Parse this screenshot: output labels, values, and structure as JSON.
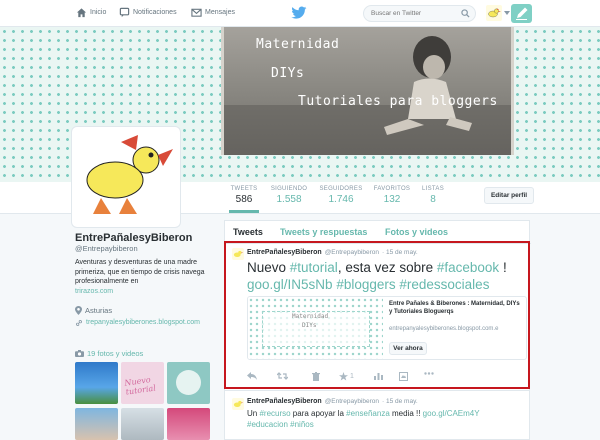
{
  "nav": {
    "home": "Inicio",
    "notifications": "Notificaciones",
    "messages": "Mensajes",
    "search_placeholder": "Buscar en Twitter"
  },
  "banner": {
    "line1": "Maternidad",
    "line2": "DIYs",
    "line3": "Tutoriales para bloggers"
  },
  "stats": [
    {
      "label": "TWEETS",
      "value": "586"
    },
    {
      "label": "SIGUIENDO",
      "value": "1.558"
    },
    {
      "label": "SEGUIDORES",
      "value": "1.746"
    },
    {
      "label": "FAVORITOS",
      "value": "132"
    },
    {
      "label": "LISTAS",
      "value": "8"
    }
  ],
  "edit_profile": "Editar perfil",
  "profile": {
    "name": "EntrePañalesyBiberon",
    "handle": "@Entrepaybiberon",
    "bio": "Aventuras y desventuras de una madre primeriza, que en tiempo de crisis navega profesionalmente en",
    "bio_link": "trirazos.com",
    "location": "Asturias",
    "website": "trepanyalesybiberones.blogspot.com",
    "media_label": "19 fotos y videos",
    "thumb_label": "Nuevo tutorial"
  },
  "tabs": {
    "tweets": "Tweets",
    "replies": "Tweets y respuestas",
    "media": "Fotos y videos"
  },
  "tweet1": {
    "name": "EntrePañalesyBiberon",
    "handle": "@Entrepaybiberon",
    "date": "· 15 de may.",
    "text_a": "Nuevo ",
    "tag_a": "#tutorial",
    "text_b": ", esta vez sobre ",
    "tag_b": "#facebook",
    "text_c": " !",
    "link": "goo.gl/IN5sNb",
    "tag_c": "#bloggers",
    "tag_d": "#redessociales",
    "card_title": "Entre Pañales & Biberones : Maternidad, DIYs y Tutoriales Bloguerqs",
    "card_url": "entrepanyalesybiberones.blogspot.com.e",
    "card_button": "Ver ahora",
    "card_img_line1": "Maternidad",
    "card_img_line2": "DIYs"
  },
  "tweet2": {
    "name": "EntrePañalesyBiberon",
    "handle": "@Entrepaybiberon",
    "date": "· 15 de may.",
    "text_a": "Un ",
    "tag_a": "#recurso",
    "text_b": " para apoyar la ",
    "tag_b": "#enseñanza",
    "text_c": " media !! ",
    "link": "goo.gl/CAEm4Y",
    "tag_c": "#educacion",
    "tag_d": "#niños"
  },
  "colors": {
    "accent": "#66b8ad",
    "highlight": "#c6171e",
    "twitter_blue": "#55acee"
  }
}
